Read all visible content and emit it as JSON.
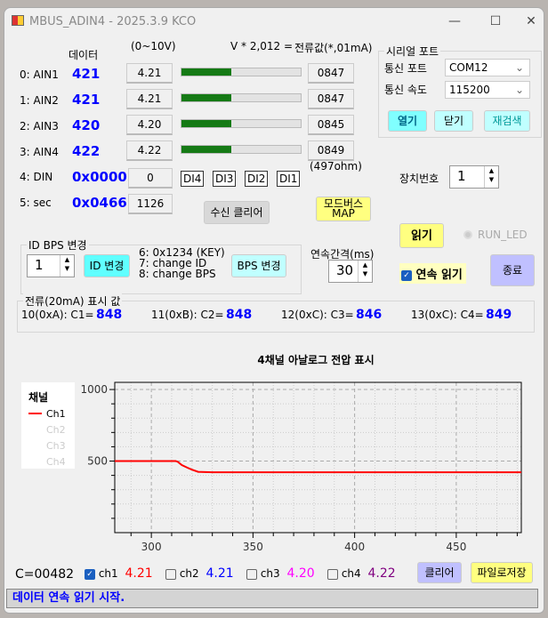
{
  "window": {
    "title": "MBUS_ADIN4 - 2025.3.9 KCO"
  },
  "headers": {
    "data": "데이터",
    "range": "(0~10V)",
    "formula": "V * 2,012 =",
    "current": "전류값(*,01mA)",
    "ohm": "(497ohm)"
  },
  "channels": [
    {
      "label": "0: AIN1",
      "raw": "421",
      "volt": "4.21",
      "current": "0847",
      "level": 0.42
    },
    {
      "label": "1: AIN2",
      "raw": "421",
      "volt": "4.21",
      "current": "0847",
      "level": 0.42
    },
    {
      "label": "2: AIN3",
      "raw": "420",
      "volt": "4.20",
      "current": "0845",
      "level": 0.42
    },
    {
      "label": "3: AIN4",
      "raw": "422",
      "volt": "4.22",
      "current": "0849",
      "level": 0.42
    }
  ],
  "din": {
    "label": "4: DIN",
    "hex": "0x0000",
    "value": "0",
    "bits": [
      "DI4",
      "DI3",
      "DI2",
      "DI1"
    ]
  },
  "sec": {
    "label": "5: sec",
    "hex": "0x0466",
    "value": "1126"
  },
  "buttons": {
    "clear_rx": "수신 클리어",
    "modbus_map": "모드버스 MAP",
    "read": "읽기",
    "exit": "종료",
    "id_change": "ID 변경",
    "bps_change": "BPS 변경",
    "open": "열기",
    "close": "닫기",
    "rescan": "재검색",
    "clear": "클리어",
    "save_file": "파일로저장"
  },
  "serial": {
    "title": "시리얼 포트",
    "port_label": "통신 포트",
    "port": "COM12",
    "speed_label": "통신 속도",
    "speed": "115200"
  },
  "device": {
    "label": "장치번호",
    "value": "1"
  },
  "run_led": "RUN_LED",
  "idbps": {
    "title": "ID  BPS 변경",
    "value": "1",
    "notes": [
      "6: 0x1234 (KEY)",
      "7: change ID",
      "8: change BPS"
    ]
  },
  "interval": {
    "label": "연속간격(ms)",
    "value": "30"
  },
  "continuous": {
    "label": "연속 읽기",
    "checked": true
  },
  "current_group": {
    "title": "전류(20mA) 표시 값",
    "items": [
      {
        "label": "10(0xA): C1=",
        "value": "848"
      },
      {
        "label": "11(0xB): C2=",
        "value": "848"
      },
      {
        "label": "12(0xC): C3=",
        "value": "846"
      },
      {
        "label": "13(0xC): C4=",
        "value": "849"
      }
    ]
  },
  "counter": "C=00482",
  "checks": [
    {
      "label": "ch1",
      "value": "4.21",
      "checked": true,
      "color": "#ff0000"
    },
    {
      "label": "ch2",
      "value": "4.21",
      "checked": false,
      "color": "#0000ff"
    },
    {
      "label": "ch3",
      "value": "4.20",
      "checked": false,
      "color": "#ff00ff"
    },
    {
      "label": "ch4",
      "value": "4.22",
      "checked": false,
      "color": "#800080"
    }
  ],
  "status": "데이터 연속 읽기 시작.",
  "chart_data": {
    "type": "line",
    "title": "4채널 아날로그 전압 표시",
    "legend_title": "채널",
    "legend_placement": "left",
    "xlim": [
      282,
      482
    ],
    "ylim": [
      0,
      1050
    ],
    "xticks": [
      300,
      350,
      400,
      450
    ],
    "yticks": [
      500,
      1000
    ],
    "series": [
      {
        "name": "Ch1",
        "color": "#ff0000",
        "x": [
          282,
          300,
          312,
          313,
          315,
          318,
          320,
          323,
          330,
          400,
          482
        ],
        "y": [
          500,
          500,
          500,
          495,
          472,
          452,
          440,
          425,
          422,
          422,
          422
        ]
      },
      {
        "name": "Ch2",
        "color": "#cccccc",
        "x": [],
        "y": []
      },
      {
        "name": "Ch3",
        "color": "#cccccc",
        "x": [],
        "y": []
      },
      {
        "name": "Ch4",
        "color": "#cccccc",
        "x": [],
        "y": []
      }
    ]
  }
}
